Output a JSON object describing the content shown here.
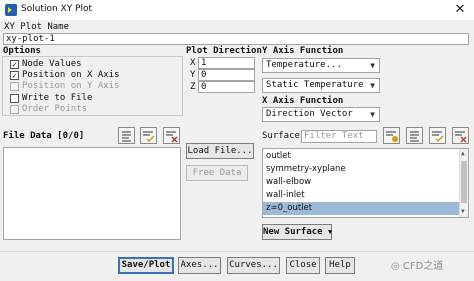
{
  "window": {
    "title": "Solution XY Plot",
    "close_glyph": "✕"
  },
  "plot_name": {
    "label": "XY Plot Name",
    "value": "xy-plot-1"
  },
  "options": {
    "heading": "Options",
    "items": [
      {
        "label": "Node Values",
        "checked": true,
        "enabled": true
      },
      {
        "label": "Position on X Axis",
        "checked": true,
        "enabled": true
      },
      {
        "label": "Position on Y Axis",
        "checked": false,
        "enabled": false
      },
      {
        "label": "Write to File",
        "checked": false,
        "enabled": true
      },
      {
        "label": "Order Points",
        "checked": false,
        "enabled": false
      }
    ]
  },
  "plot_direction": {
    "heading": "Plot Direction",
    "x_label": "X",
    "x_value": "1",
    "y_label": "Y",
    "y_value": "0",
    "z_label": "Z",
    "z_value": "0"
  },
  "y_axis": {
    "heading": "Y Axis Function",
    "category": "Temperature...",
    "quantity": "Static Temperature"
  },
  "x_axis": {
    "heading": "X Axis Function",
    "value": "Direction Vector"
  },
  "file_data": {
    "heading": "File Data [0/0]",
    "load_button": "Load File...",
    "free_button": "Free Data"
  },
  "surfaces": {
    "heading": "Surfaces",
    "filter_placeholder": "Filter Text",
    "items": [
      {
        "label": "outlet",
        "selected": false
      },
      {
        "label": "symmetry-xyplane",
        "selected": false
      },
      {
        "label": "wall-elbow",
        "selected": false
      },
      {
        "label": "wall-inlet",
        "selected": false
      },
      {
        "label": "z=0_outlet",
        "selected": true
      }
    ],
    "new_surface_button": "New Surface"
  },
  "buttons": {
    "save": "Save/Plot",
    "axes": "Axes...",
    "curves": "Curves...",
    "close": "Close",
    "help": "Help"
  },
  "watermark": "CFD之道",
  "icons": {
    "app": "fluent-app-icon",
    "chat": "wechat-icon"
  },
  "colors": {
    "accent": "#3b6fb6",
    "selection": "#9cbad6"
  }
}
